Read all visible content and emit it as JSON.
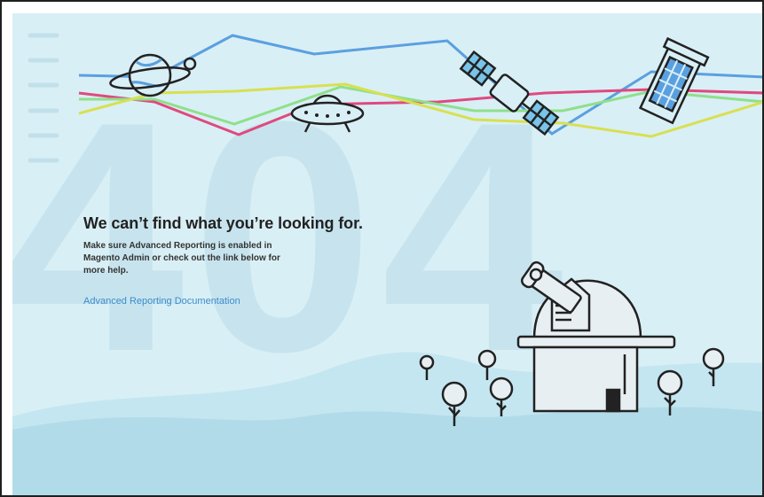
{
  "background_label": "404",
  "error": {
    "headline": "We can’t find what you’re looking for.",
    "description": "Make sure Advanced Reporting is enabled in Magento Admin or check out the link below for more help.",
    "link_label": "Advanced Reporting Documentation"
  },
  "colors": {
    "sky": "#d9eff6",
    "big_404": "#c7e4ee",
    "hills": "#b8dfeb",
    "hills_front": "#a9d7e6",
    "line_blue": "#5aa0e0",
    "line_pink": "#df4a7e",
    "line_green": "#8fe08a",
    "line_yellow": "#d8e050",
    "link": "#3b8ccd",
    "outline": "#222222"
  },
  "icons": [
    "planet-icon",
    "ufo-icon",
    "satellite-icon",
    "space-phone-booth-icon",
    "observatory-icon",
    "tree-icon"
  ]
}
